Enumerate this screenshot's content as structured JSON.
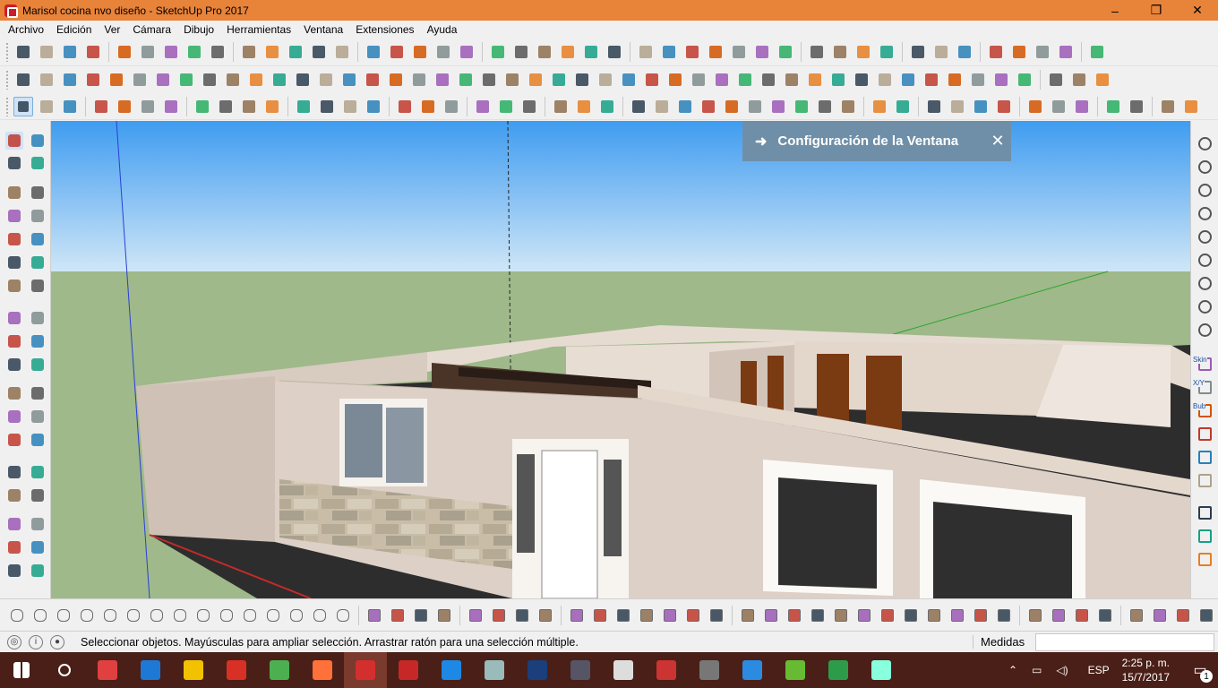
{
  "window": {
    "title": "Marisol cocina nvo diseño - SketchUp Pro 2017",
    "minimize": "–",
    "maximize": "❐",
    "close": "✕"
  },
  "menu": [
    "Archivo",
    "Edición",
    "Ver",
    "Cámara",
    "Dibujo",
    "Herramientas",
    "Ventana",
    "Extensiones",
    "Ayuda"
  ],
  "panel": {
    "arrow": "➜",
    "label": "Configuración de la Ventana",
    "close": "✕"
  },
  "status": {
    "text": "Seleccionar objetos. Mayúsculas para ampliar selección. Arrastrar ratón para una selección múltiple.",
    "measure_label": "Medidas",
    "measure_value": "",
    "icons": [
      "geo-location-icon",
      "info-icon",
      "user-icon"
    ]
  },
  "right_labels": [
    "Skin",
    "X/Y",
    "Bub"
  ],
  "taskbar": {
    "lang": "ESP",
    "time": "2:25 p. m.",
    "date": "15/7/2017",
    "notifications": "1",
    "apps": [
      "start-icon",
      "search-icon",
      "store-icon",
      "edge-icon",
      "file-explorer-icon",
      "app-red-icon",
      "chrome-icon",
      "firefox-icon",
      "sketchup-icon",
      "solidworks-icon",
      "app-blue-ring-icon",
      "app-plane-icon",
      "app-dots-icon",
      "app-tank-icon",
      "calculator-icon",
      "app-truck-icon",
      "app-car-icon",
      "app-blue-square-icon",
      "app-green-stack-icon",
      "app-globe-icon",
      "app-cube-icon"
    ]
  },
  "colors": {
    "titlebar": "#e8833a",
    "taskbar": "#4a1f17",
    "sky_top": "#3f9cf0",
    "ground": "#9fb98a",
    "wall": "#ddd0c6",
    "panel": "#6f8fa8"
  }
}
